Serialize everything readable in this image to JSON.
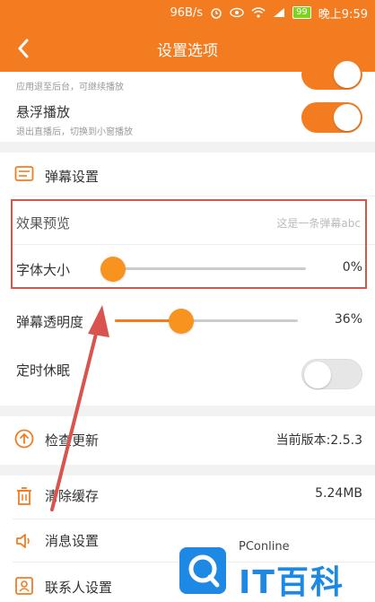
{
  "status_bar": {
    "speed": "96B/s",
    "battery": "99",
    "time": "晚上9:59"
  },
  "nav": {
    "title": "设置选项"
  },
  "playback": {
    "background_desc": "应用退至后台，可继续播放",
    "float_label": "悬浮播放",
    "float_desc": "退出直播后，切换到小窗播放",
    "background_toggle": true,
    "float_toggle": true
  },
  "danmaku": {
    "header": "弹幕设置",
    "preview_label": "效果预览",
    "preview_value": "这是一条弹幕abc",
    "font_size_label": "字体大小",
    "font_size_value": "0%",
    "font_size_level": 0,
    "opacity_label": "弹幕透明度",
    "opacity_value": "36%",
    "opacity_level": 0.36,
    "sleep_label": "定时休眠",
    "sleep_toggle": false
  },
  "update": {
    "label": "检查更新",
    "value": "当前版本:2.5.3"
  },
  "misc": {
    "clear_cache_label": "清除缓存",
    "clear_cache_value": "5.24MB",
    "message_label": "消息设置",
    "contacts_label": "联系人设置"
  },
  "watermark": {
    "brand": "PConline",
    "text": "IT百科"
  },
  "colors": {
    "accent": "#f47c20",
    "highlight_box": "#d9534f"
  }
}
